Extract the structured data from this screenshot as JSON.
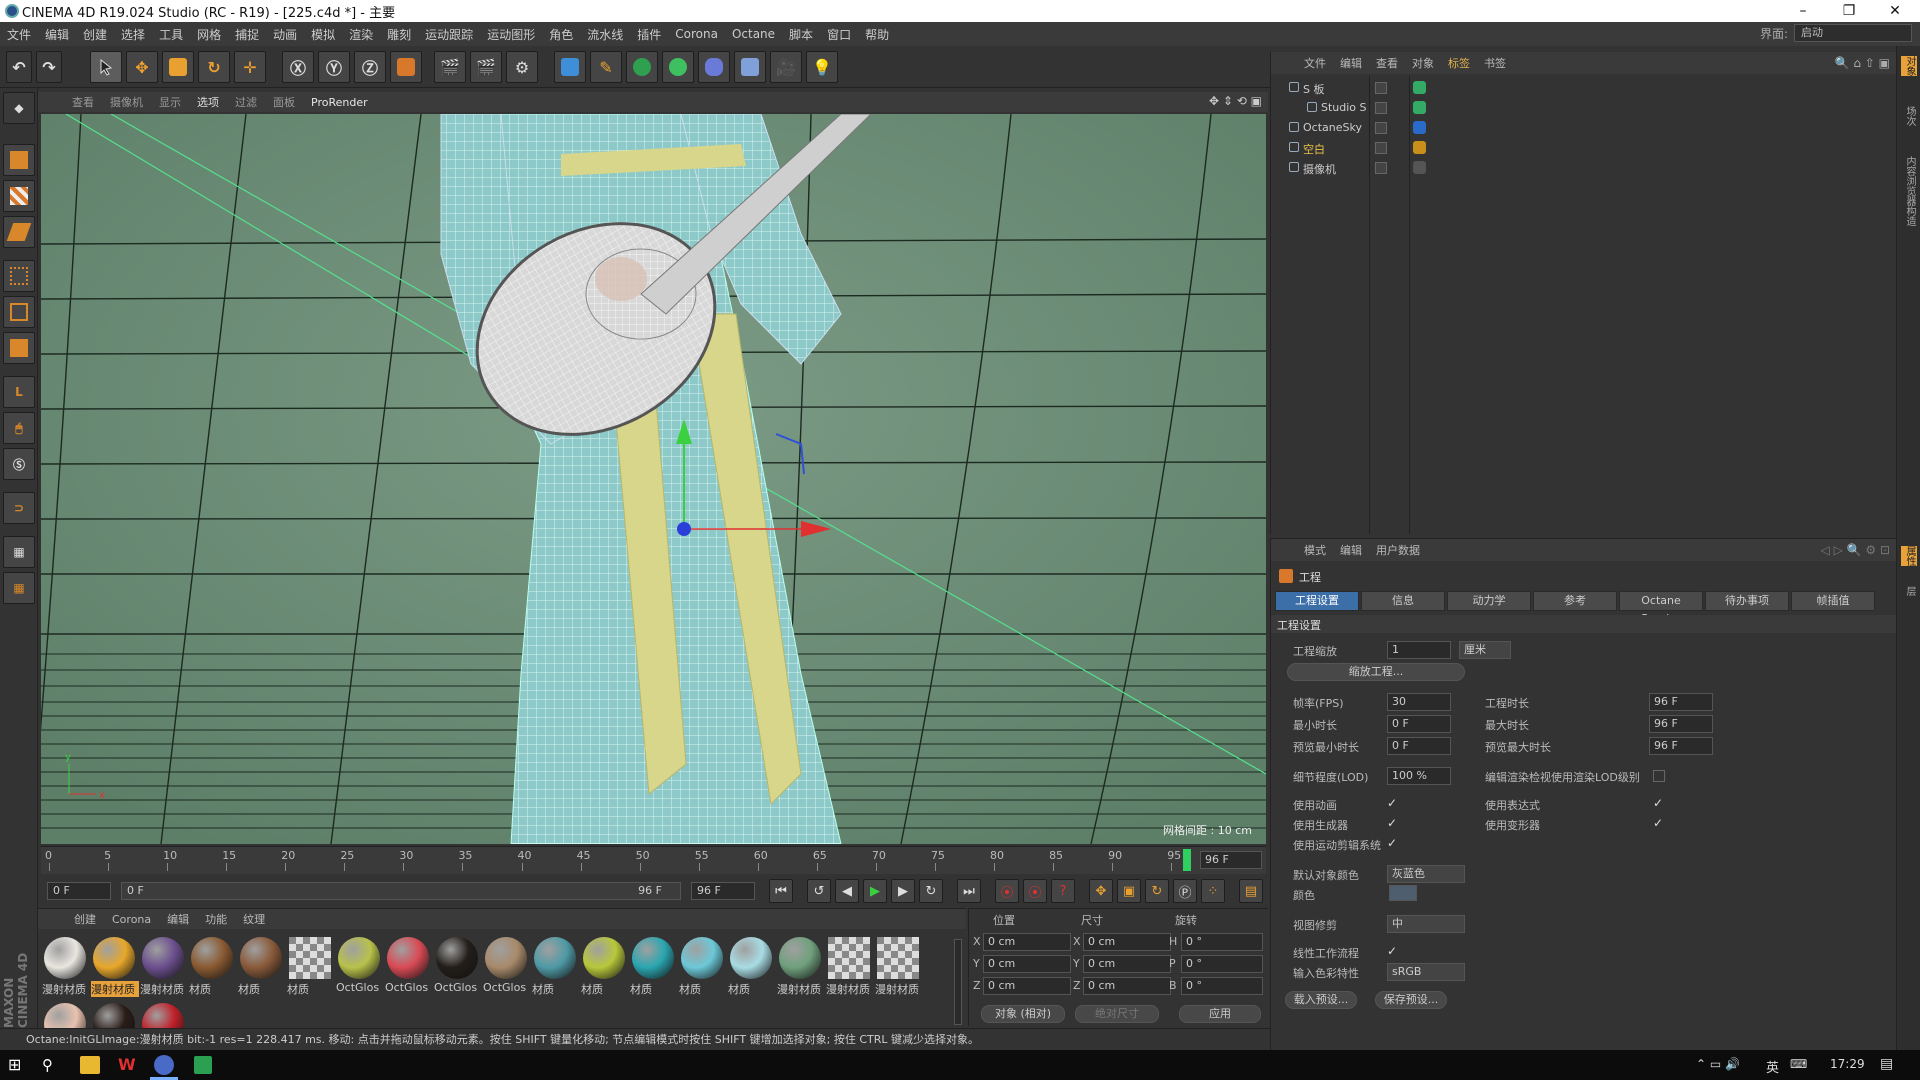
{
  "window": {
    "title": "CINEMA 4D R19.024 Studio (RC - R19) - [225.c4d *] - 主要",
    "minimize": "–",
    "restore": "❐",
    "close": "✕"
  },
  "menubar": {
    "items": [
      "文件",
      "编辑",
      "创建",
      "选择",
      "工具",
      "网格",
      "捕捉",
      "动画",
      "模拟",
      "渲染",
      "雕刻",
      "运动跟踪",
      "运动图形",
      "角色",
      "流水线",
      "插件",
      "Corona",
      "Octane",
      "脚本",
      "窗口",
      "帮助"
    ],
    "layout_label": "界面:",
    "layout_value": "启动"
  },
  "viewport": {
    "menu": [
      "查看",
      "摄像机",
      "显示",
      "选项",
      "过滤",
      "面板",
      "ProRender"
    ],
    "grid_info": "网格间距 : 10 cm",
    "axis_x": "x",
    "axis_y": "y"
  },
  "timeline": {
    "ticks": [
      "0",
      "5",
      "10",
      "15",
      "20",
      "25",
      "30",
      "35",
      "40",
      "45",
      "50",
      "55",
      "60",
      "65",
      "70",
      "75",
      "80",
      "85",
      "90",
      "95"
    ],
    "current_end": "96 F"
  },
  "playbar": {
    "start": "0 F",
    "range_start": "0 F",
    "range_end": "96 F",
    "end": "96 F"
  },
  "materials": {
    "tabs": [
      "创建",
      "Corona",
      "编辑",
      "功能",
      "纹理"
    ],
    "items": [
      {
        "label": "漫射材质",
        "color": "#e9e6e0"
      },
      {
        "label": "漫射材质",
        "color": "#e8a72a",
        "selected": true
      },
      {
        "label": "漫射材质",
        "color": "#6b4f8e"
      },
      {
        "label": "材质",
        "color": "#8a5a32"
      },
      {
        "label": "材质",
        "color": "#8a5a3a"
      },
      {
        "label": "材质",
        "color": "checker"
      },
      {
        "label": "OctGlos",
        "color": "#b8c24a"
      },
      {
        "label": "OctGlos",
        "color": "#d94a55"
      },
      {
        "label": "OctGlos",
        "color": "#231e1a"
      },
      {
        "label": "OctGlos",
        "color": "#a88a6a"
      },
      {
        "label": "材质",
        "color": "#4f9aa6"
      },
      {
        "label": "材质",
        "color": "#b8c83a"
      },
      {
        "label": "材质",
        "color": "#2aa6b0"
      },
      {
        "label": "材质",
        "color": "#6cc8d8"
      },
      {
        "label": "材质",
        "color": "#a8dce4"
      },
      {
        "label": "漫射材质",
        "color": "#6fa07c"
      },
      {
        "label": "漫射材质",
        "color": "checker"
      },
      {
        "label": "漫射材质",
        "color": "checker"
      },
      {
        "label": "",
        "color": "#e8c2b0"
      },
      {
        "label": "",
        "color": "#2a1c18"
      },
      {
        "label": "",
        "color": "#c0202a"
      }
    ]
  },
  "coordinates": {
    "headers": [
      "位置",
      "尺寸",
      "旋转"
    ],
    "rows": [
      {
        "axis": "X",
        "pos": "0 cm",
        "size_axis": "X",
        "size": "0 cm",
        "rot_axis": "H",
        "rot": "0 °"
      },
      {
        "axis": "Y",
        "pos": "0 cm",
        "size_axis": "Y",
        "size": "0 cm",
        "rot_axis": "P",
        "rot": "0 °"
      },
      {
        "axis": "Z",
        "pos": "0 cm",
        "size_axis": "Z",
        "size": "0 cm",
        "rot_axis": "B",
        "rot": "0 °"
      }
    ],
    "mode": "对象 (相对)",
    "size_mode": "绝对尺寸",
    "apply": "应用"
  },
  "status": {
    "text": "Octane:InitGLImage:漫射材质  bit:-1 res=1  228.417 ms.     移动: 点击并拖动鼠标移动元素。按住 SHIFT 键量化移动; 节点编辑模式时按住 SHIFT 键增加选择对象; 按住 CTRL 键减少选择对象。"
  },
  "objects": {
    "menu": [
      "文件",
      "编辑",
      "查看",
      "对象",
      "标签",
      "书签"
    ],
    "items": [
      {
        "name": "S 板",
        "indent": 0,
        "color": "#ccc"
      },
      {
        "name": "Studio S",
        "indent": 1,
        "color": "#ccc"
      },
      {
        "name": "OctaneSky",
        "indent": 0,
        "color": "#ccc"
      },
      {
        "name": "空白",
        "indent": 0,
        "color": "#e8c24a"
      },
      {
        "name": "摄像机",
        "indent": 0,
        "color": "#ccc"
      }
    ]
  },
  "attributes": {
    "menu": [
      "模式",
      "编辑",
      "用户数据"
    ],
    "title": "工程",
    "tabs": [
      "工程设置",
      "信息",
      "动力学",
      "参考",
      "Octane Render",
      "待办事项",
      "帧插值"
    ],
    "section": "工程设置",
    "scale_label": "工程缩放",
    "scale_value": "1",
    "scale_unit": "厘米",
    "scale_button": "缩放工程...",
    "fps_label": "帧率(FPS)",
    "fps_value": "30",
    "project_len_label": "工程时长",
    "project_len_value": "96 F",
    "min_time_label": "最小时长",
    "min_time_value": "0 F",
    "max_time_label": "最大时长",
    "max_time_value": "96 F",
    "preview_min_label": "预览最小时长",
    "preview_min_value": "0 F",
    "preview_max_label": "预览最大时长",
    "preview_max_value": "96 F",
    "lod_label": "细节程度(LOD)",
    "lod_value": "100 %",
    "lod_render_label": "编辑渲染检视使用渲染LOD级别",
    "use_anim_label": "使用动画",
    "use_expr_label": "使用表达式",
    "use_gen_label": "使用生成器",
    "use_deform_label": "使用变形器",
    "use_mograph_label": "使用运动剪辑系统",
    "default_color_label": "默认对象颜色",
    "default_color_value": "灰蓝色",
    "color_label": "颜色",
    "view_clip_label": "视图修剪",
    "view_clip_value": "中",
    "linear_label": "线性工作流程",
    "input_color_label": "输入色彩特性",
    "input_color_value": "sRGB",
    "load_preset": "载入预设...",
    "save_preset": "保存预设..."
  },
  "rightstrip": [
    "对象",
    "场次",
    "内容浏览器",
    "构造"
  ],
  "rightstrip2": [
    "属性",
    "层"
  ],
  "taskbar": {
    "time": "17:29",
    "ime": "英"
  },
  "colors": {
    "accent": "#3c6ea8",
    "highlight": "#e8a23c",
    "viewport_bg": "#6d8e77"
  }
}
